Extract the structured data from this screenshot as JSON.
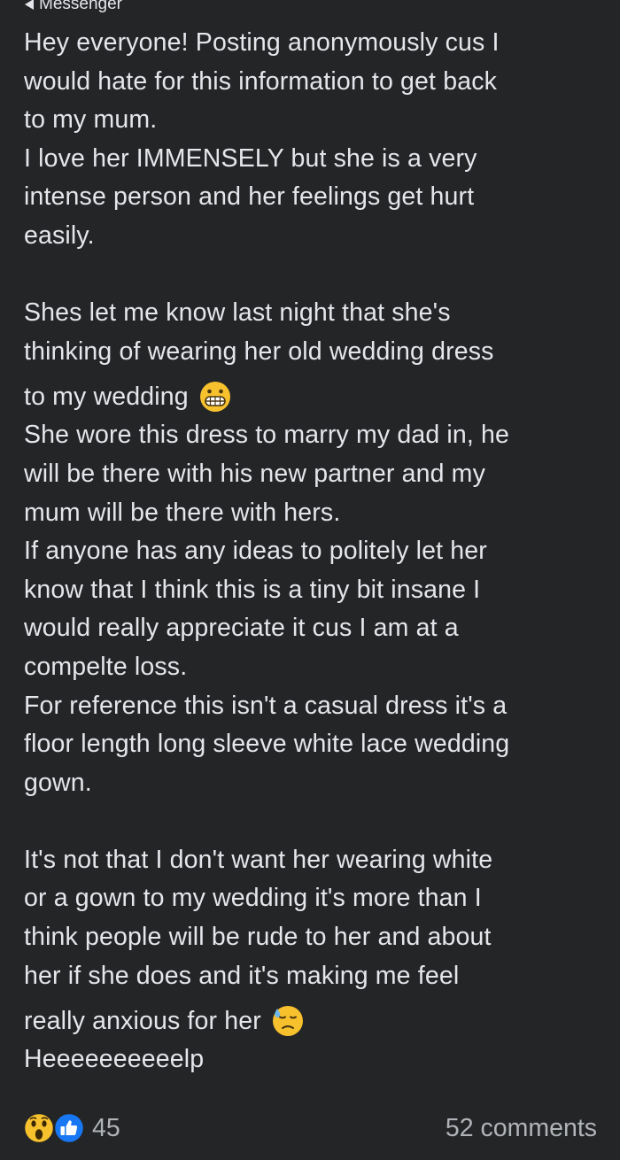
{
  "status_bar": {
    "back_label": "Messenger"
  },
  "post": {
    "paragraph_1": [
      "Hey everyone! Posting anonymously cus I",
      "would hate for this information to get back",
      "to my mum.",
      "I love her IMMENSELY but she is a very",
      "intense person and her feelings get hurt",
      "easily."
    ],
    "paragraph_2": {
      "line_1": "Shes let me know last night that she's",
      "line_2": "thinking of wearing her old wedding dress",
      "line_3": "to my wedding",
      "line_3_emoji": "grimacing-face-emoji",
      "rest": [
        "She wore this dress to marry my dad in, he",
        "will be there with his new partner and my",
        "mum will be there with hers.",
        "If anyone has any ideas to politely let her",
        "know that I think this is a tiny bit insane I",
        "would really appreciate it cus I am at a",
        "compelte loss.",
        "For reference this isn't a casual dress it's a",
        "floor length long sleeve white lace wedding",
        "gown."
      ]
    },
    "paragraph_3": {
      "lines": [
        "It's not that I don't want her wearing white",
        "or a gown to my wedding it's more than I",
        "think people will be rude to her and about",
        "her if she does and it's making me feel"
      ],
      "emoji_line": "really anxious for her",
      "emoji_line_emoji": "anxious-face-with-sweat-emoji",
      "last_line": "Heeeeeeeeeelp"
    }
  },
  "reactions": {
    "icons": [
      "wow-reaction-icon",
      "like-reaction-icon"
    ],
    "count": "45",
    "comments": "52 comments"
  },
  "colors": {
    "background": "#242526",
    "text": "#e4e6eb",
    "secondary_text": "#b0b3b8",
    "like_blue": "#1877f2",
    "emoji_yellow": "#f7c12e"
  }
}
